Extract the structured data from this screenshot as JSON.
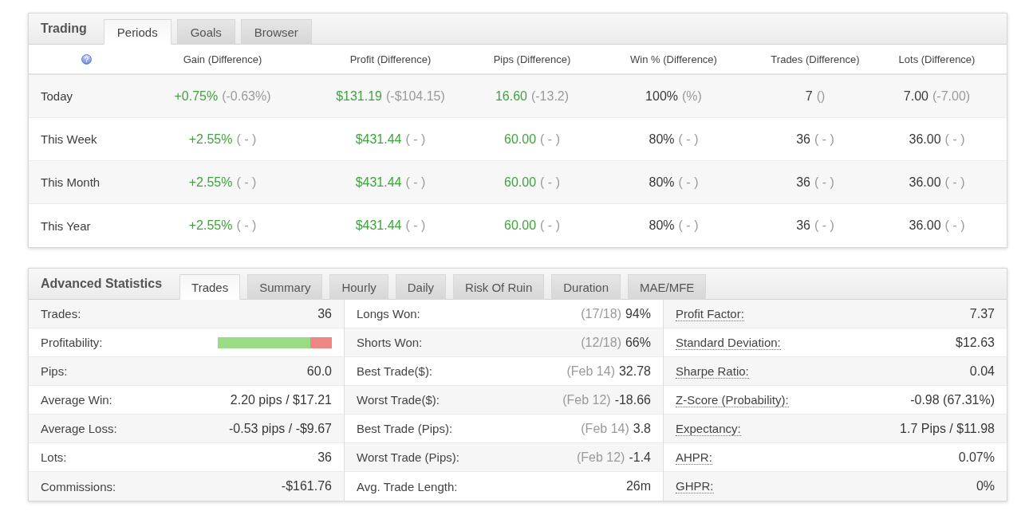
{
  "trading": {
    "title": "Trading",
    "tabs": [
      {
        "label": "Periods",
        "selected": true
      },
      {
        "label": "Goals",
        "selected": false
      },
      {
        "label": "Browser",
        "selected": false
      }
    ],
    "columns": [
      "Gain (Difference)",
      "Profit (Difference)",
      "Pips (Difference)",
      "Win % (Difference)",
      "Trades (Difference)",
      "Lots (Difference)"
    ],
    "rows": [
      {
        "period": "Today",
        "cells": [
          {
            "value": "+0.75%",
            "positive": true,
            "difference": "(-0.63%)"
          },
          {
            "value": "$131.19",
            "positive": true,
            "difference": "(-$104.15)"
          },
          {
            "value": "16.60",
            "positive": true,
            "difference": "(-13.2)"
          },
          {
            "value": "100%",
            "positive": false,
            "difference": "(%)"
          },
          {
            "value": "7",
            "positive": false,
            "difference": "()"
          },
          {
            "value": "7.00",
            "positive": false,
            "difference": "(-7.00)"
          }
        ]
      },
      {
        "period": "This Week",
        "cells": [
          {
            "value": "+2.55%",
            "positive": true,
            "difference": "( - )"
          },
          {
            "value": "$431.44",
            "positive": true,
            "difference": "( - )"
          },
          {
            "value": "60.00",
            "positive": true,
            "difference": "( - )"
          },
          {
            "value": "80%",
            "positive": false,
            "difference": "( - )"
          },
          {
            "value": "36",
            "positive": false,
            "difference": "( - )"
          },
          {
            "value": "36.00",
            "positive": false,
            "difference": "( - )"
          }
        ]
      },
      {
        "period": "This Month",
        "cells": [
          {
            "value": "+2.55%",
            "positive": true,
            "difference": "( - )"
          },
          {
            "value": "$431.44",
            "positive": true,
            "difference": "( - )"
          },
          {
            "value": "60.00",
            "positive": true,
            "difference": "( - )"
          },
          {
            "value": "80%",
            "positive": false,
            "difference": "( - )"
          },
          {
            "value": "36",
            "positive": false,
            "difference": "( - )"
          },
          {
            "value": "36.00",
            "positive": false,
            "difference": "( - )"
          }
        ]
      },
      {
        "period": "This Year",
        "cells": [
          {
            "value": "+2.55%",
            "positive": true,
            "difference": "( - )"
          },
          {
            "value": "$431.44",
            "positive": true,
            "difference": "( - )"
          },
          {
            "value": "60.00",
            "positive": true,
            "difference": "( - )"
          },
          {
            "value": "80%",
            "positive": false,
            "difference": "( - )"
          },
          {
            "value": "36",
            "positive": false,
            "difference": "( - )"
          },
          {
            "value": "36.00",
            "positive": false,
            "difference": "( - )"
          }
        ]
      }
    ]
  },
  "advanced_statistics": {
    "title": "Advanced Statistics",
    "tabs": [
      {
        "label": "Trades",
        "selected": true
      },
      {
        "label": "Summary",
        "selected": false
      },
      {
        "label": "Hourly",
        "selected": false
      },
      {
        "label": "Daily",
        "selected": false
      },
      {
        "label": "Risk Of Ruin",
        "selected": false
      },
      {
        "label": "Duration",
        "selected": false
      },
      {
        "label": "MAE/MFE",
        "selected": false
      }
    ],
    "columns": [
      [
        {
          "kind": "text",
          "label": "Trades:",
          "value": "36",
          "has_tooltip": false
        },
        {
          "kind": "bar",
          "label": "Profitability:",
          "level": 0.81,
          "has_tooltip": false
        },
        {
          "kind": "text",
          "label": "Pips:",
          "value": "60.0",
          "has_tooltip": false
        },
        {
          "kind": "text",
          "label": "Average Win:",
          "value": "2.20 pips / $17.21",
          "has_tooltip": false
        },
        {
          "kind": "text",
          "label": "Average Loss:",
          "value": "-0.53 pips / -$9.67",
          "has_tooltip": false
        },
        {
          "kind": "text",
          "label": "Lots:",
          "value": "36",
          "has_tooltip": false
        },
        {
          "kind": "text",
          "label": "Commissions:",
          "value": "-$161.76",
          "has_tooltip": false
        }
      ],
      [
        {
          "kind": "text",
          "label": "Longs Won:",
          "note": "(17/18)",
          "value": "94%",
          "has_tooltip": false
        },
        {
          "kind": "text",
          "label": "Shorts Won:",
          "note": "(12/18)",
          "value": "66%",
          "has_tooltip": false
        },
        {
          "kind": "text",
          "label": "Best Trade($):",
          "note": "(Feb 14)",
          "value": "32.78",
          "has_tooltip": false
        },
        {
          "kind": "text",
          "label": "Worst Trade($):",
          "note": "(Feb 12)",
          "value": "-18.66",
          "has_tooltip": false
        },
        {
          "kind": "text",
          "label": "Best Trade (Pips):",
          "note": "(Feb 14)",
          "value": "3.8",
          "has_tooltip": false
        },
        {
          "kind": "text",
          "label": "Worst Trade (Pips):",
          "note": "(Feb 12)",
          "value": "-1.4",
          "has_tooltip": false
        },
        {
          "kind": "text",
          "label": "Avg. Trade Length:",
          "value": "26m",
          "has_tooltip": false
        }
      ],
      [
        {
          "kind": "text",
          "label": "Profit Factor:",
          "value": "7.37",
          "has_tooltip": true
        },
        {
          "kind": "text",
          "label": "Standard Deviation:",
          "value": "$12.63",
          "has_tooltip": true
        },
        {
          "kind": "text",
          "label": "Sharpe Ratio:",
          "value": "0.04",
          "has_tooltip": true
        },
        {
          "kind": "text",
          "label": "Z-Score (Probability):",
          "value": "-0.98 (67.31%)",
          "has_tooltip": true
        },
        {
          "kind": "text",
          "label": "Expectancy:",
          "value": "1.7 Pips / $11.98",
          "has_tooltip": true
        },
        {
          "kind": "text",
          "label": "AHPR:",
          "value": "0.07%",
          "has_tooltip": true
        },
        {
          "kind": "text",
          "label": "GHPR:",
          "value": "0%",
          "has_tooltip": true
        }
      ]
    ]
  }
}
